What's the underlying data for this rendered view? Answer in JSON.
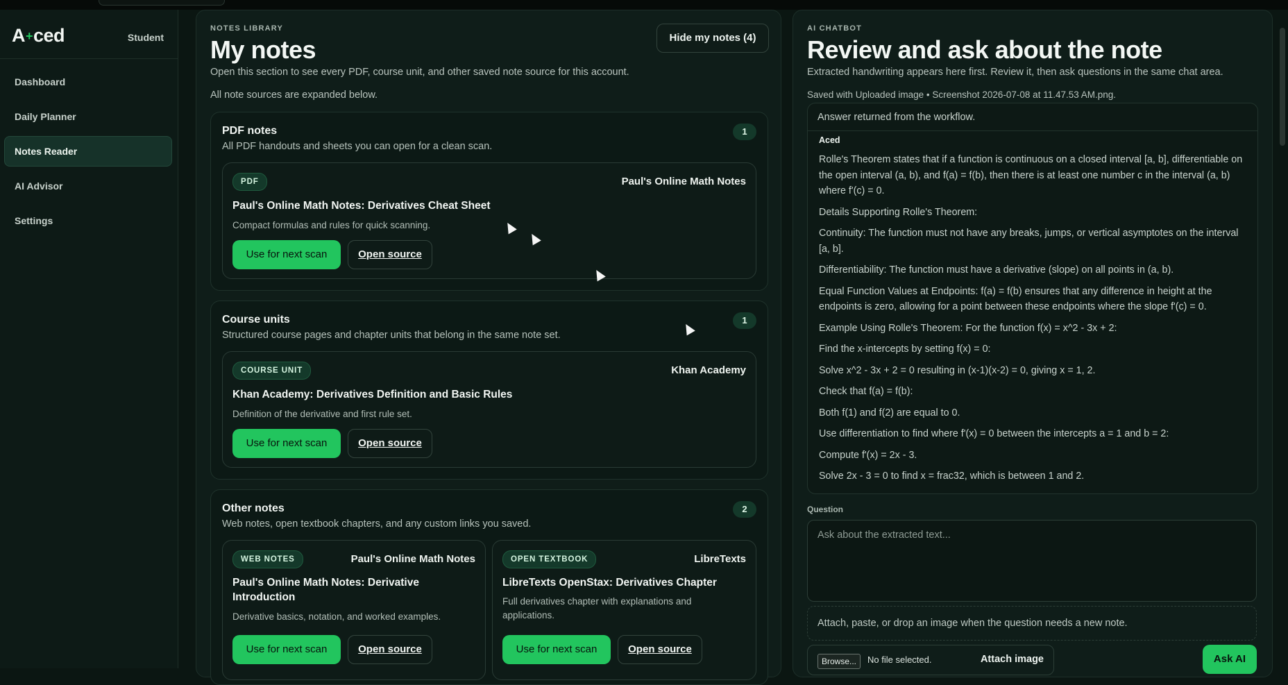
{
  "app": {
    "logo_left": "A",
    "logo_right": "ced",
    "role": "Student"
  },
  "sidebar": {
    "items": [
      {
        "label": "Dashboard"
      },
      {
        "label": "Daily Planner"
      },
      {
        "label": "Notes Reader",
        "active": true
      },
      {
        "label": "AI Advisor"
      },
      {
        "label": "Settings"
      }
    ]
  },
  "library": {
    "eyebrow": "NOTES LIBRARY",
    "title": "My notes",
    "description": "Open this section to see every PDF, course unit, and other saved note source for this account.",
    "expanded_note": "All note sources are expanded below.",
    "hide_button": "Hide my notes (4)",
    "use_label": "Use for next scan",
    "open_label": "Open source",
    "groups": [
      {
        "title": "PDF notes",
        "description": "All PDF handouts and sheets you can open for a clean scan.",
        "count": "1",
        "cards": [
          {
            "tag": "PDF",
            "source": "Paul's Online Math Notes",
            "title": "Paul's Online Math Notes: Derivatives Cheat Sheet",
            "description": "Compact formulas and rules for quick scanning."
          }
        ]
      },
      {
        "title": "Course units",
        "description": "Structured course pages and chapter units that belong in the same note set.",
        "count": "1",
        "cards": [
          {
            "tag": "COURSE UNIT",
            "source": "Khan Academy",
            "title": "Khan Academy: Derivatives Definition and Basic Rules",
            "description": "Definition of the derivative and first rule set."
          }
        ]
      },
      {
        "title": "Other notes",
        "description": "Web notes, open textbook chapters, and any custom links you saved.",
        "count": "2",
        "cards": [
          {
            "tag": "WEB NOTES",
            "source": "Paul's Online Math Notes",
            "title": "Paul's Online Math Notes: Derivative Introduction",
            "description": "Derivative basics, notation, and worked examples."
          },
          {
            "tag": "OPEN TEXTBOOK",
            "source": "LibreTexts",
            "title": "LibreTexts OpenStax: Derivatives Chapter",
            "description": "Full derivatives chapter with explanations and applications."
          }
        ]
      }
    ]
  },
  "chatbot": {
    "eyebrow": "AI CHATBOT",
    "title": "Review and ask about the note",
    "description": "Extracted handwriting appears here first. Review it, then ask questions in the same chat area.",
    "saved_with": "Saved with Uploaded image • Screenshot 2026-07-08 at 11.47.53 AM.png.",
    "status": "Answer returned from the workflow.",
    "sender": "Aced",
    "message": [
      "Rolle's Theorem states that if a function is continuous on a closed interval [a, b], differentiable on the open interval (a, b), and f(a) = f(b), then there is at least one number c in the interval (a, b) where f'(c) = 0.",
      "Details Supporting Rolle's Theorem:",
      "Continuity: The function must not have any breaks, jumps, or vertical asymptotes on the interval [a, b].",
      "Differentiability: The function must have a derivative (slope) on all points in (a, b).",
      "Equal Function Values at Endpoints: f(a) = f(b) ensures that any difference in height at the endpoints is zero, allowing for a point between these endpoints where the slope f'(c) = 0.",
      "Example Using Rolle's Theorem: For the function f(x) = x^2 - 3x + 2:",
      "Find the x-intercepts by setting f(x) = 0:",
      "Solve x^2 - 3x + 2 = 0 resulting in (x-1)(x-2) = 0, giving x = 1, 2.",
      "Check that f(a) = f(b):",
      "Both f(1) and f(2) are equal to 0.",
      "Use differentiation to find where f'(x) = 0 between the intercepts a = 1 and b = 2:",
      "Compute f'(x) = 2x - 3.",
      "Solve 2x - 3 = 0 to find x = frac32, which is between 1 and 2."
    ],
    "question_label": "Question",
    "question_placeholder": "Ask about the extracted text...",
    "drop_hint": "Attach, paste, or drop an image when the question needs a new note.",
    "browse_label": "Browse...",
    "file_status": "No file selected.",
    "attach_label": "Attach image",
    "ask_label": "Ask AI"
  },
  "colors": {
    "accent": "#22c55e",
    "background": "#0b1612",
    "panel": "#0f1d19"
  }
}
